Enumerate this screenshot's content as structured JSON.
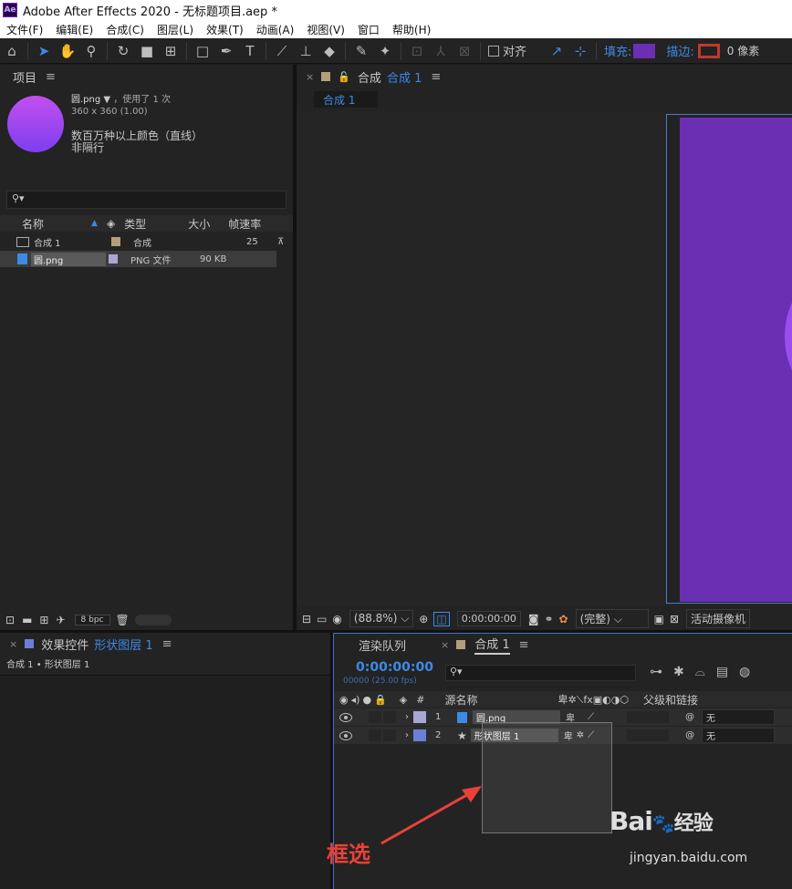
{
  "app": {
    "title": "Adobe After Effects 2020 - 无标题项目.aep *",
    "logo": "Ae"
  },
  "menu": [
    "文件(F)",
    "编辑(E)",
    "合成(C)",
    "图层(L)",
    "效果(T)",
    "动画(A)",
    "视图(V)",
    "窗口",
    "帮助(H)"
  ],
  "toolbar": {
    "snap_label": "对齐",
    "fill_label": "填充:",
    "stroke_label": "描边:",
    "stroke_px": "0 像素",
    "fill_color": "#6a2fb3",
    "stroke_color": "#c0392b"
  },
  "project": {
    "title": "项目",
    "asset_name": "圆.png",
    "asset_used": "，使用了 1 次",
    "asset_dims": "360 x 360 (1.00)",
    "asset_colors": "数百万种以上颜色（直线）",
    "asset_interlace": "非隔行",
    "columns": [
      "名称",
      "类型",
      "大小",
      "帧速率"
    ],
    "items": [
      {
        "name": "合成 1",
        "type": "合成",
        "size": "",
        "fps": "25",
        "label_color": "#b59e7a"
      },
      {
        "name": "圆.png",
        "type": "PNG 文件",
        "size": "90 KB",
        "fps": "",
        "label_color": "#a9a6d6"
      }
    ],
    "bpc": "8 bpc"
  },
  "viewer": {
    "tab_prefix": "合成",
    "tab_name": "合成 1",
    "breadcrumb": "合成 1",
    "zoom": "(88.8%)",
    "timecode": "0:00:00:00",
    "quality": "(完整)",
    "camera": "活动摄像机",
    "canvas_color": "#6a2fb3"
  },
  "effects": {
    "title_prefix": "效果控件",
    "layer_name": "形状图层 1",
    "breadcrumb": "合成 1 • 形状图层 1"
  },
  "timeline": {
    "tab_render": "渲染队列",
    "tab_comp": "合成 1",
    "timecode": "0:00:00:00",
    "frames": "00000 (25.00 fps)",
    "col_source": "源名称",
    "col_parent": "父级和链接",
    "layers": [
      {
        "num": "1",
        "name": "圆.png",
        "parent": "无",
        "label_color": "#a9a6d6"
      },
      {
        "num": "2",
        "name": "形状图层 1",
        "parent": "无",
        "label_color": "#6b7fd6"
      }
    ]
  },
  "annotation": {
    "text": "框选",
    "color": "#e8413a"
  },
  "watermark": {
    "brand": "Bai",
    "brand_suffix": "经验",
    "url": "jingyan.baidu.com"
  }
}
